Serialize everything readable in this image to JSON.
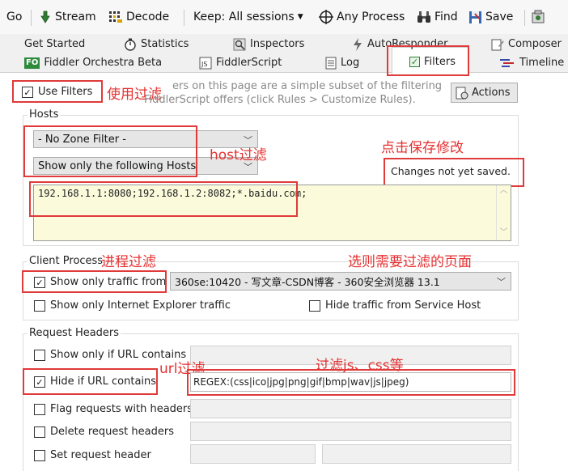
{
  "toolbar": {
    "go": "Go",
    "stream": "Stream",
    "decode": "Decode",
    "keep": "Keep: All sessions",
    "any_process": "Any Process",
    "find": "Find",
    "save": "Save"
  },
  "tabs_row1": [
    "Get Started",
    "Statistics",
    "Inspectors",
    "AutoResponder",
    "Composer"
  ],
  "tabs_row2": [
    "Fiddler Orchestra Beta",
    "FiddlerScript",
    "Log",
    "Filters",
    "Timeline"
  ],
  "filters": {
    "use_filters": "Use Filters",
    "info_line1": "ers on this page are a simple subset of the filtering",
    "info_line2": "FiddlerScript offers (click Rules > Customize Rules).",
    "actions": "Actions",
    "hosts": {
      "title": "Hosts",
      "zone_filter": "- No Zone Filter -",
      "host_mode": "Show only the following Hosts",
      "changes_status": "Changes not yet saved.",
      "host_list": "192.168.1.1:8080;192.168.1.2:8082;*.baidu.com;"
    },
    "client_process": {
      "title": "Client Process",
      "show_only_traffic_from": "Show only traffic from",
      "process_value": "360se:10420 - 写文章-CSDN博客 - 360安全浏览器 13.1",
      "show_only_ie": "Show only Internet Explorer traffic",
      "hide_service_host": "Hide traffic from Service Host"
    },
    "request_headers": {
      "title": "Request Headers",
      "show_only_url": "Show only if URL contains",
      "hide_if_url": "Hide if URL contains",
      "hide_url_value": "REGEX:(css|ico|jpg|png|gif|bmp|wav|js|jpeg)",
      "flag_requests": "Flag requests with headers",
      "delete_headers": "Delete request headers",
      "set_header": "Set request header"
    }
  },
  "annotations": {
    "use_filters_note": "使用过滤",
    "host_note": "host过滤",
    "save_note": "点击保存修改",
    "process_note": "进程过滤",
    "page_note": "选则需要过滤的页面",
    "url_note": "url过滤",
    "js_css_note": "过滤js、css等"
  },
  "colors": {
    "annotation_red": "#e53030",
    "host_list_bg": "#fbfbdc"
  }
}
